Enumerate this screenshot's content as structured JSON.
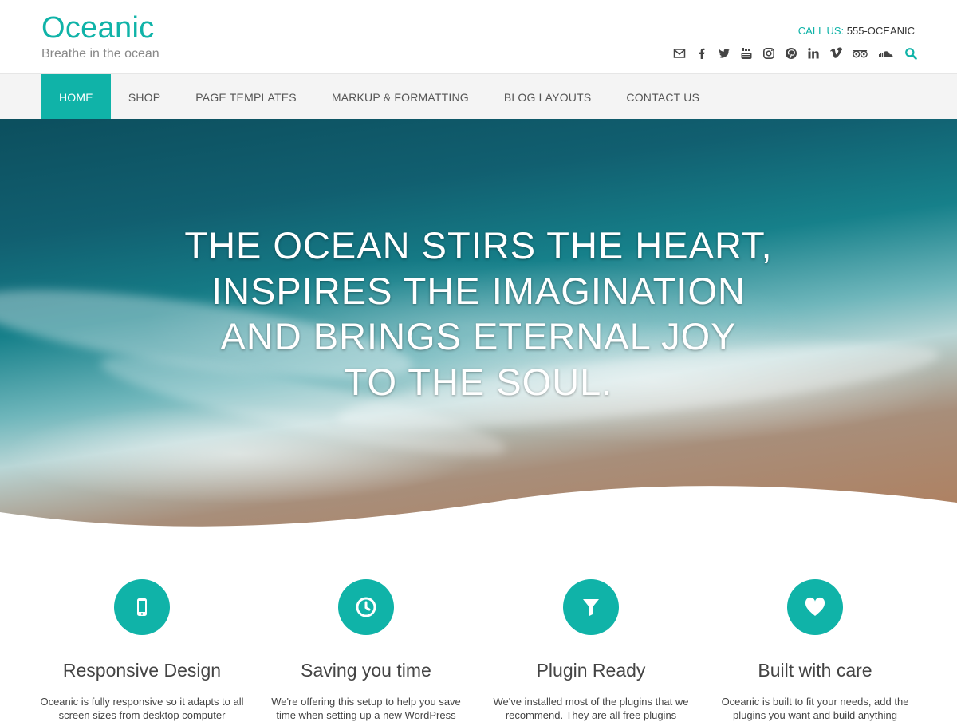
{
  "site": {
    "title": "Oceanic",
    "tagline": "Breathe in the ocean"
  },
  "contact": {
    "label": "CALL US:",
    "phone": "555-OCEANIC"
  },
  "social_icons": [
    "envelope-icon",
    "facebook-icon",
    "twitter-icon",
    "youtube-icon",
    "instagram-icon",
    "pinterest-icon",
    "linkedin-icon",
    "vimeo-icon",
    "tripadvisor-icon",
    "soundcloud-icon",
    "search-icon"
  ],
  "nav": {
    "items": [
      {
        "label": "HOME",
        "active": true
      },
      {
        "label": "SHOP"
      },
      {
        "label": "PAGE TEMPLATES"
      },
      {
        "label": "MARKUP & FORMATTING"
      },
      {
        "label": "BLOG LAYOUTS"
      },
      {
        "label": "CONTACT US"
      }
    ]
  },
  "hero": {
    "lines": [
      "THE OCEAN STIRS THE HEART,",
      "INSPIRES THE IMAGINATION",
      "AND BRINGS ETERNAL JOY",
      "TO THE SOUL."
    ]
  },
  "features": [
    {
      "icon": "mobile-phone-icon",
      "title": "Responsive Design",
      "text": "Oceanic is fully responsive so it adapts to all screen sizes from desktop computer"
    },
    {
      "icon": "clock-icon",
      "title": "Saving you time",
      "text": "We're offering this setup to help you save time when setting up a new WordPress"
    },
    {
      "icon": "filter-icon",
      "title": "Plugin Ready",
      "text": "We've installed most of the plugins that we recommend. They are all free plugins"
    },
    {
      "icon": "heart-icon",
      "title": "Built with care",
      "text": "Oceanic is built to fit your needs, add the plugins you want and build anything"
    }
  ],
  "colors": {
    "accent": "#10b3a8",
    "nav_bg": "#f4f4f4",
    "text": "#444444"
  }
}
